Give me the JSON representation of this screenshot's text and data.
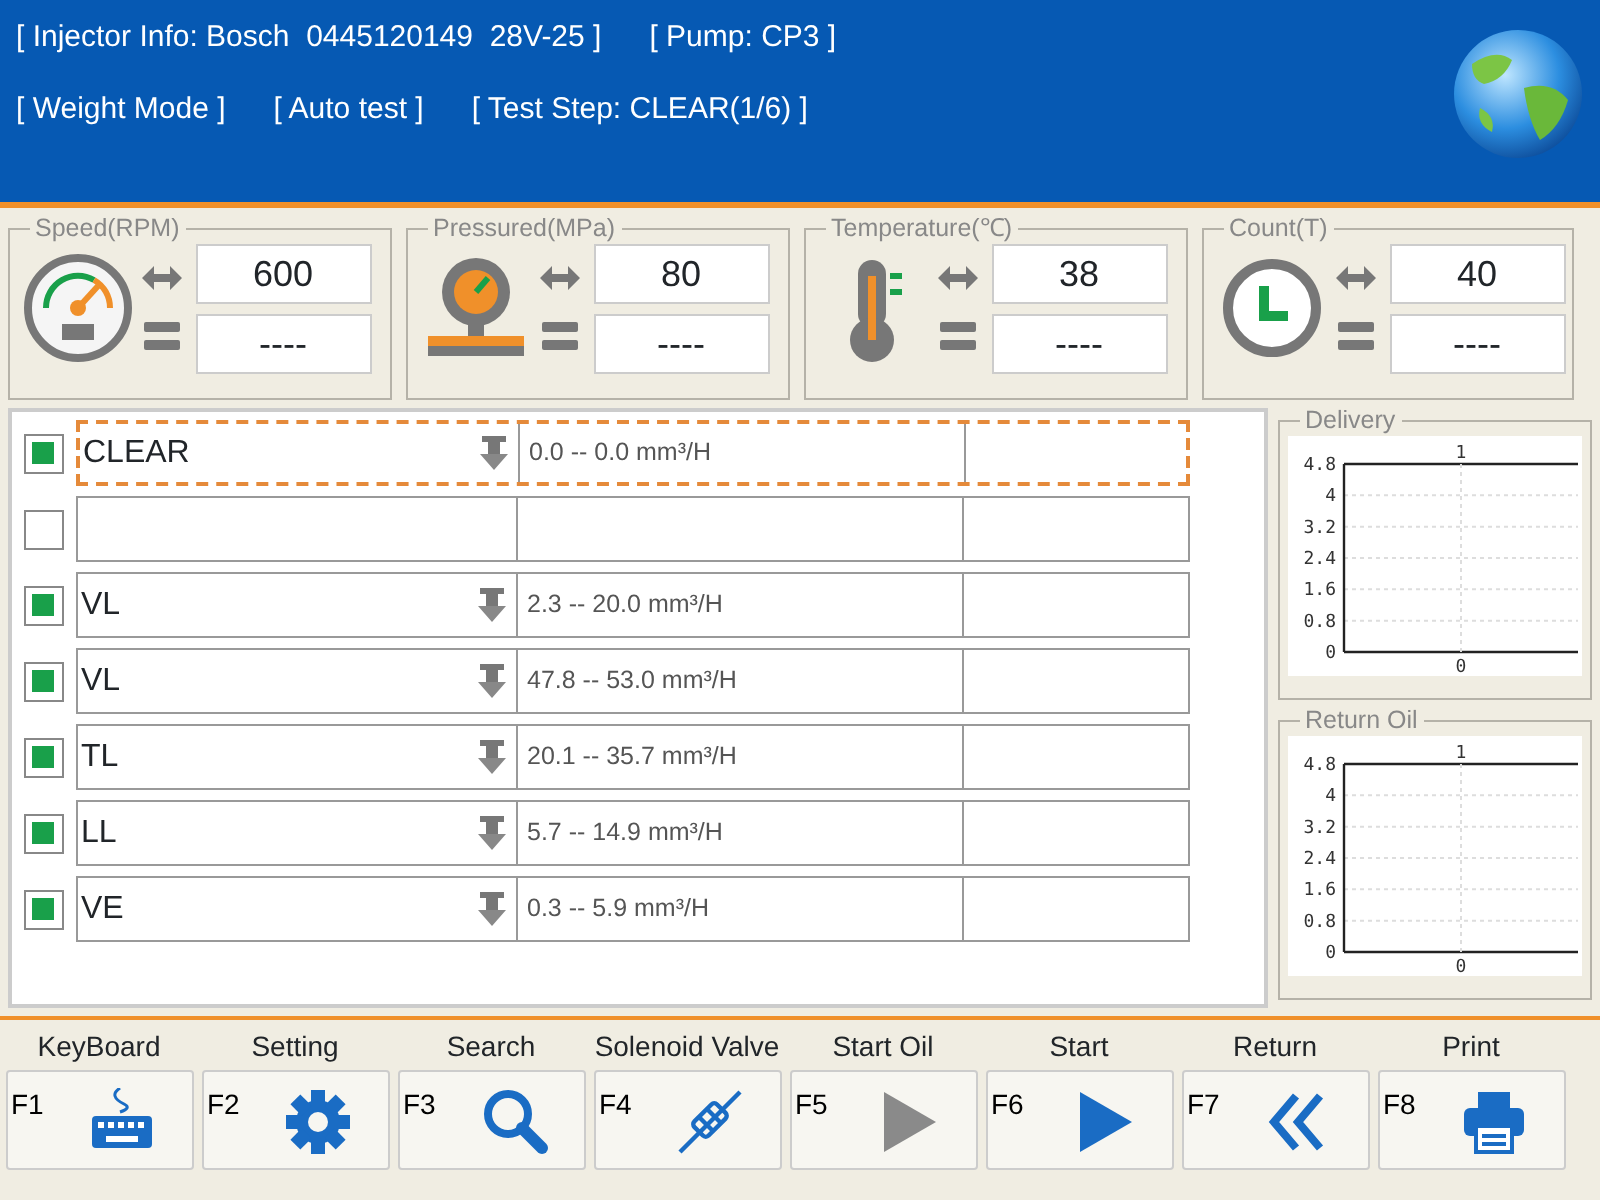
{
  "header": {
    "lines": [
      [
        "[ Injector Info: Bosch  0445120149  28V-25 ]",
        "[ Pump: CP3 ]"
      ],
      [
        "[ Weight Mode ]",
        "[ Auto test ]",
        "[ Test Step: CLEAR(1/6) ]"
      ]
    ]
  },
  "gauges": [
    {
      "kind": "speed",
      "title": "Speed(RPM)",
      "set_value": "600",
      "actual_value": "----"
    },
    {
      "kind": "pressure",
      "title": "Pressured(MPa)",
      "set_value": "80",
      "actual_value": "----"
    },
    {
      "kind": "temperature",
      "title": "Temperature(℃)",
      "set_value": "38",
      "actual_value": "----"
    },
    {
      "kind": "count",
      "title": "Count(T)",
      "set_value": "40",
      "actual_value": "----"
    }
  ],
  "test_steps": [
    {
      "label": "CLEAR",
      "range": "0.0 -- 0.0 mm³/H",
      "checked": true,
      "selected": true
    },
    {
      "checked": false,
      "selected": false
    },
    {
      "label": "VL",
      "range": "2.3 -- 20.0 mm³/H",
      "checked": true,
      "selected": false
    },
    {
      "label": "VL",
      "range": "47.8 -- 53.0 mm³/H",
      "checked": true,
      "selected": false
    },
    {
      "label": "TL",
      "range": "20.1 -- 35.7 mm³/H",
      "checked": true,
      "selected": false
    },
    {
      "label": "LL",
      "range": "5.7 -- 14.9 mm³/H",
      "checked": true,
      "selected": false
    },
    {
      "label": "VE",
      "range": "0.3 -- 5.9 mm³/H",
      "checked": true,
      "selected": false
    }
  ],
  "charts": [
    {
      "title": "Delivery",
      "top_label": "1",
      "chart_data": {
        "type": "line",
        "grid": true,
        "categories": [
          "0"
        ],
        "values": [
          null
        ],
        "ylim": [
          0,
          4.8
        ],
        "yticks": [
          0,
          0.8,
          1.6,
          2.4,
          3.2,
          4,
          4.8
        ]
      }
    },
    {
      "title": "Return Oil",
      "top_label": "1",
      "chart_data": {
        "type": "line",
        "grid": true,
        "categories": [
          "0"
        ],
        "values": [
          null
        ],
        "ylim": [
          0,
          4.8
        ],
        "yticks": [
          0,
          0.8,
          1.6,
          2.4,
          3.2,
          4,
          4.8
        ]
      }
    }
  ],
  "toolbar": [
    {
      "label": "KeyBoard",
      "key": "F1",
      "kind": "keyboard",
      "disabled": false
    },
    {
      "label": "Setting",
      "key": "F2",
      "kind": "settings",
      "disabled": false
    },
    {
      "label": "Search",
      "key": "F3",
      "kind": "search",
      "disabled": false
    },
    {
      "label": "Solenoid Valve",
      "key": "F4",
      "kind": "valve",
      "disabled": false
    },
    {
      "label": "Start Oil",
      "key": "F5",
      "kind": "play",
      "disabled": true
    },
    {
      "label": "Start",
      "key": "F6",
      "kind": "play",
      "disabled": false
    },
    {
      "label": "Return",
      "key": "F7",
      "kind": "back",
      "disabled": false
    },
    {
      "label": "Print",
      "key": "F8",
      "kind": "print",
      "disabled": false
    }
  ]
}
